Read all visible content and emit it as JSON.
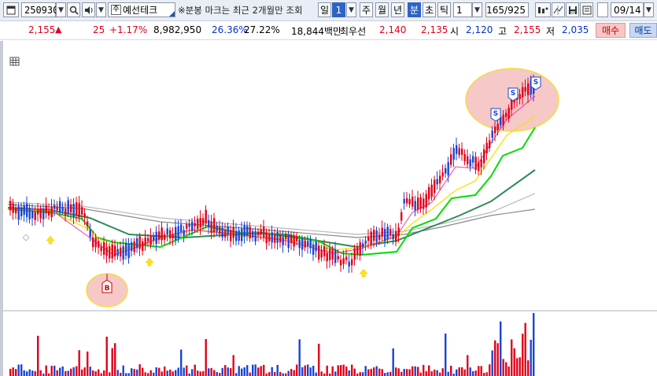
{
  "toolbar": {
    "stock_code": "250930",
    "stock_name": "예선테크",
    "notice": "※분봉 마크는 최근 2개월만 조회",
    "period_day": "일",
    "period_num": "1",
    "period_week": "주",
    "period_month": "월",
    "period_year": "년",
    "period_minute": "분",
    "period_second": "초",
    "period_tick": "틱",
    "interval_value": "1",
    "count_display": "165/925",
    "date_value": "09/14",
    "icons": [
      "window-icon",
      "search-icon",
      "speaker-icon",
      "chart-settings-icon",
      "crosshair-icon",
      "save-icon",
      "text-icon"
    ]
  },
  "info": {
    "price": "2,155",
    "change_arrow": "▲",
    "change": "25",
    "change_rate": "+1.17%",
    "volume": "8,982,950",
    "rate1": "26.36%",
    "rate2": "27.22%",
    "amount": "18,844백만",
    "best_label": "최우선",
    "best_ask": "2,140",
    "best_bid": "2,135",
    "open_label": "시",
    "open": "2,120",
    "high_label": "고",
    "high": "2,155",
    "low_label": "저",
    "low": "2,035",
    "buy_button": "매수",
    "sell_button": "매도"
  },
  "markers": {
    "buy": "B",
    "sell": "S"
  },
  "colors": {
    "up": "#e0001a",
    "down": "#1a44d6",
    "ma_green": "#00dd00",
    "ma_dark_green": "#2e8b57",
    "ma_yellow": "#f2e400",
    "highlight_fill": "#f6c8c8",
    "highlight_border": "#f5dc40"
  }
}
